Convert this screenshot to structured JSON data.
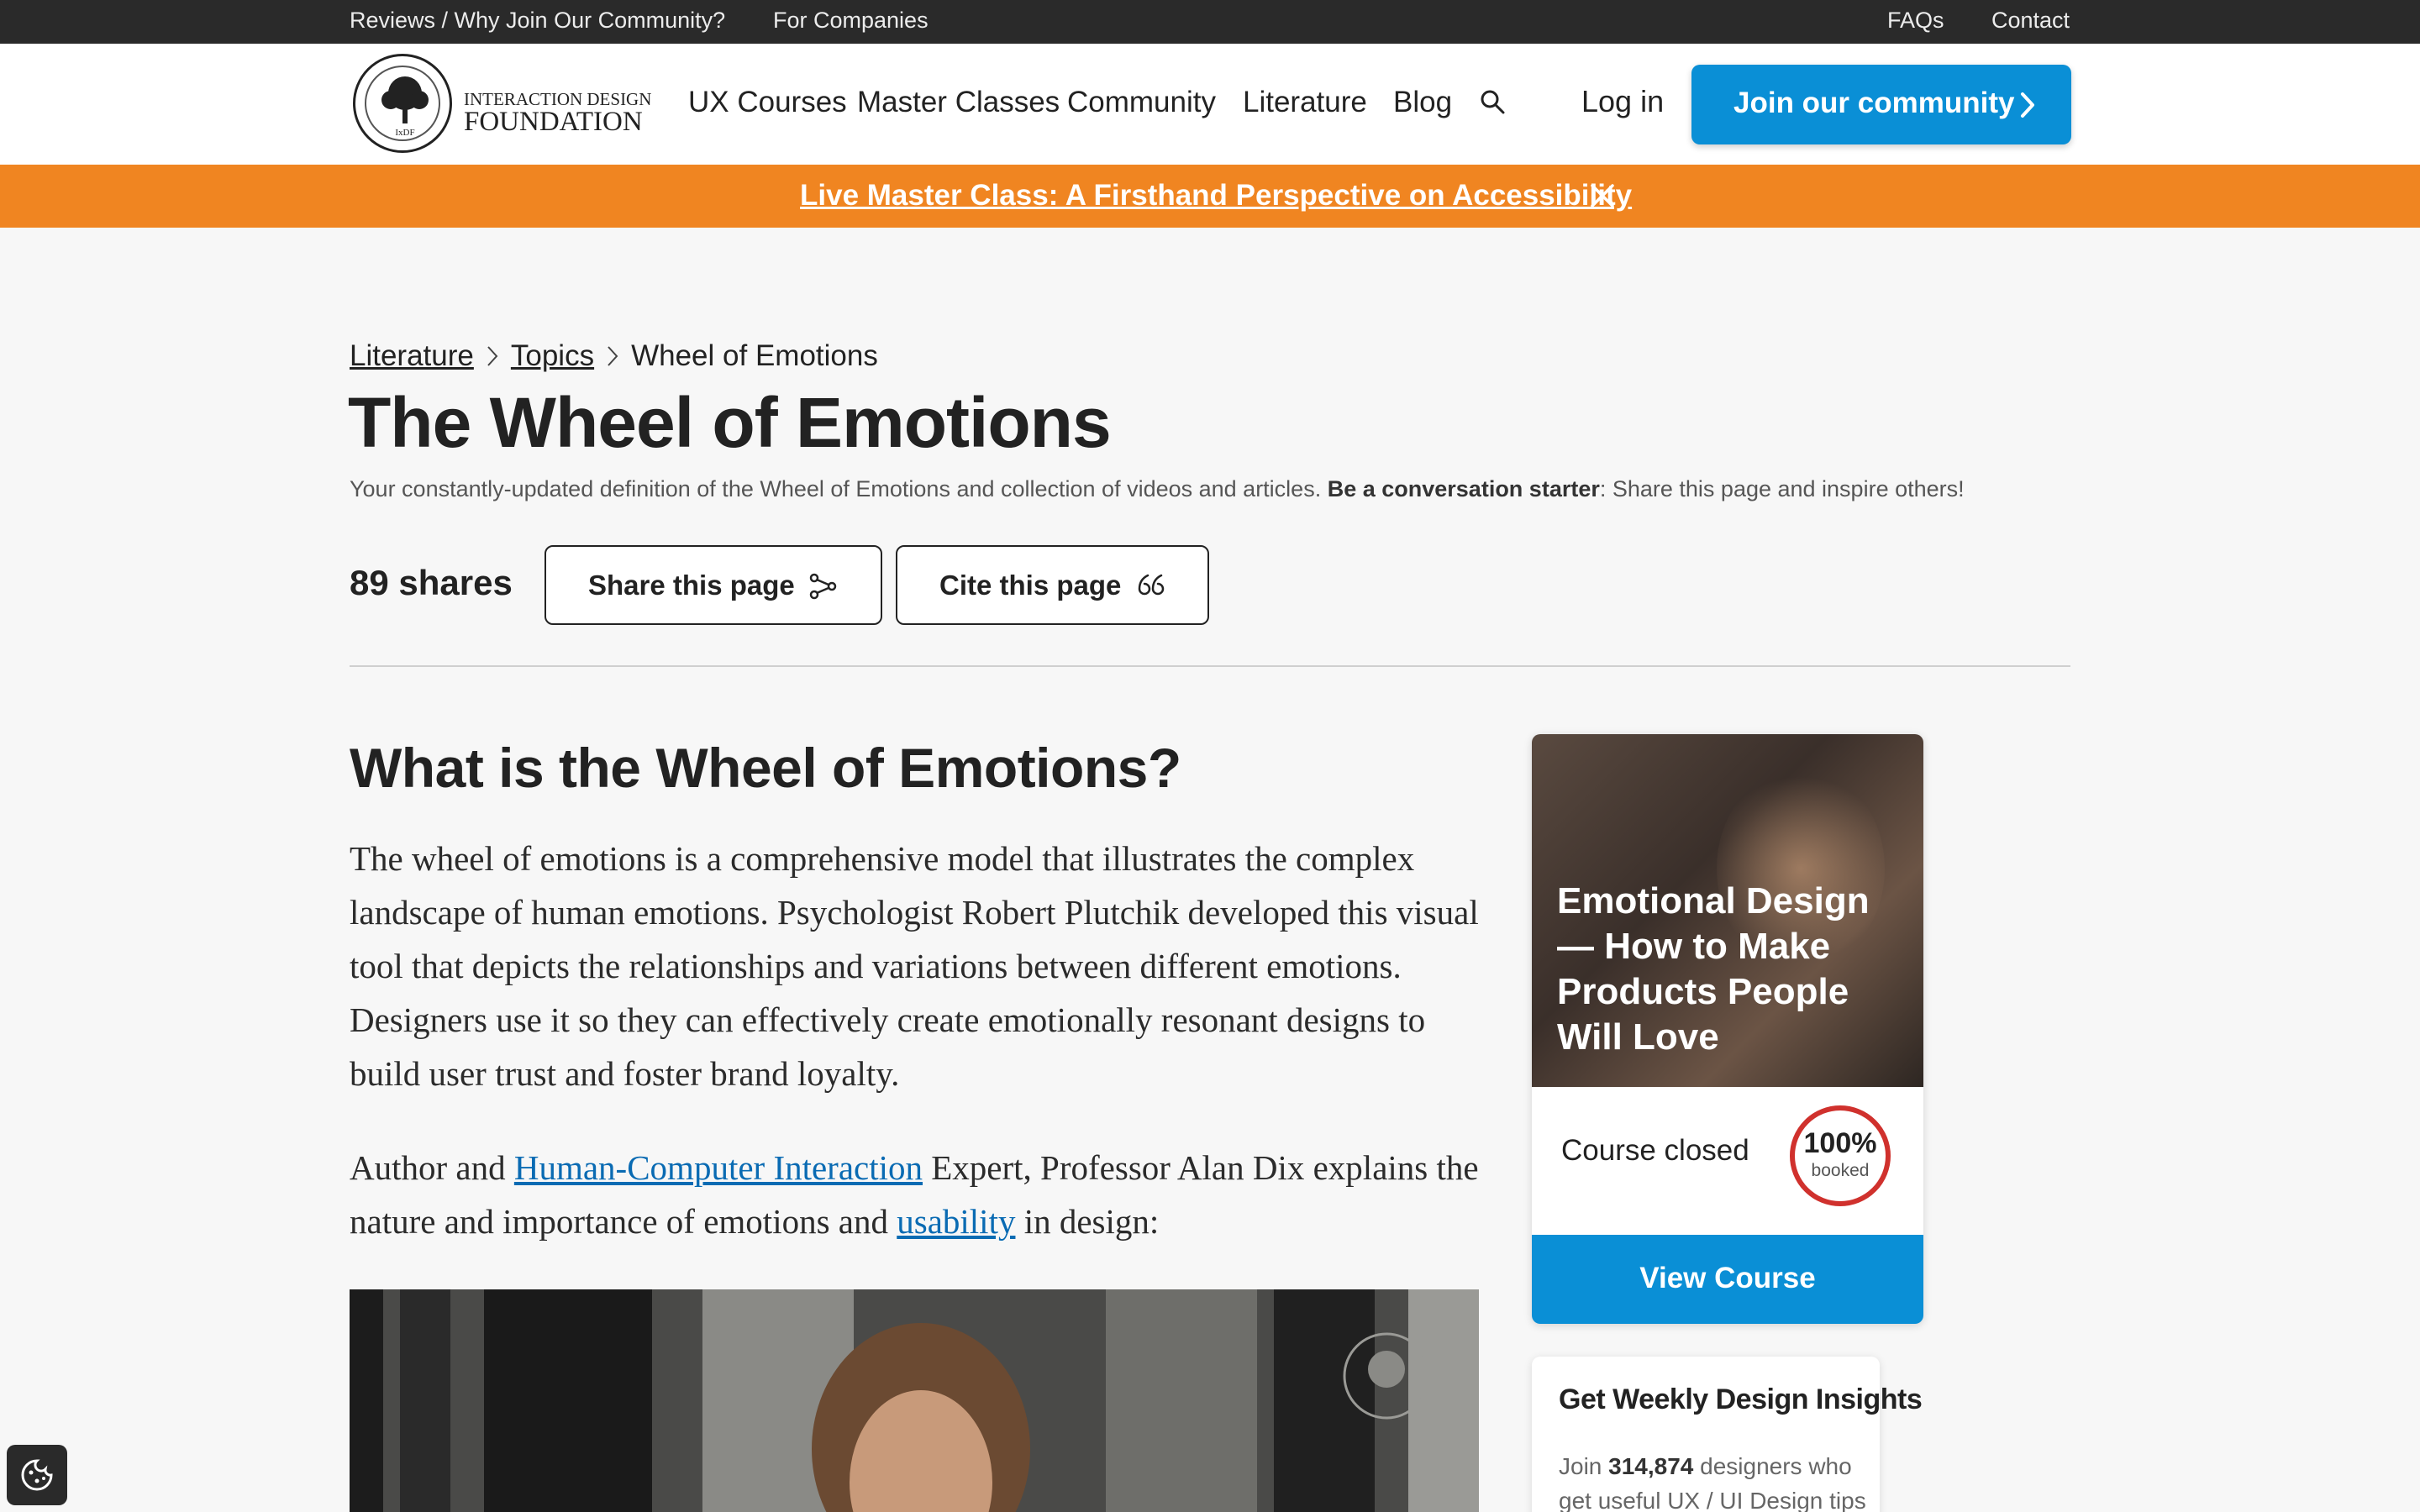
{
  "topbar": {
    "reviews": "Reviews / Why Join Our Community?",
    "companies": "For Companies",
    "faqs": "FAQs",
    "contact": "Contact"
  },
  "logo": {
    "line1": "INTERACTION DESIGN",
    "line2": "FOUNDATION",
    "seal_text": "IxDF"
  },
  "nav": {
    "items": [
      "UX Courses",
      "Master Classes",
      "Community",
      "Literature",
      "Blog"
    ],
    "login": "Log in",
    "join": "Join our community"
  },
  "banner": {
    "text": "Live Master Class: A Firsthand Perspective on Accessibility"
  },
  "breadcrumb": [
    "Literature",
    "Topics",
    "Wheel of Emotions"
  ],
  "page": {
    "title": "The Wheel of Emotions",
    "subtitle_pre": "Your constantly-updated definition of the Wheel of Emotions and collection of videos and articles.",
    "subtitle_bold": "Be a conversation starter",
    "subtitle_post": ": Share this page and inspire others!",
    "shares": "89 shares",
    "share_button": "Share this page",
    "cite_button": "Cite this page"
  },
  "article": {
    "heading": "What is the Wheel of Emotions?",
    "para1": "The wheel of emotions is a comprehensive model that illustrates the complex landscape of human emotions. Psychologist Robert Plutchik developed this visual tool that depicts the relationships and variations between different emotions. Designers use it so they can effectively create emotionally resonant designs to build user trust and foster brand loyalty.",
    "para2_a": "Author and ",
    "para2_link1": "Human-Computer Interaction",
    "para2_b": " Expert, Professor Alan Dix explains the nature and importance of emotions and ",
    "para2_link2": "usability",
    "para2_c": " in design:"
  },
  "course_card": {
    "title": "Emotional Design — How to Make Products People Will Love",
    "status": "Course closed",
    "booked_pct": "100%",
    "booked_label": "booked",
    "booked_fraction": 1.0,
    "button": "View Course"
  },
  "newsletter": {
    "title": "Get Weekly Design Insights",
    "body_pre": "Join ",
    "count": "314,874",
    "body_post": " designers who get useful UX / UI Design tips from"
  },
  "colors": {
    "accent_blue": "#0a8fd6",
    "banner_orange": "#f08521",
    "link_blue": "#0a6bb3",
    "booked_red": "#d0312d",
    "topbar_bg": "#2a2a2a"
  },
  "icons": {
    "search": "search-icon",
    "share": "share-icon",
    "cite": "quote-icon",
    "close": "close-icon",
    "chevron": "chevron-right-icon",
    "cookie": "cookie-icon"
  }
}
